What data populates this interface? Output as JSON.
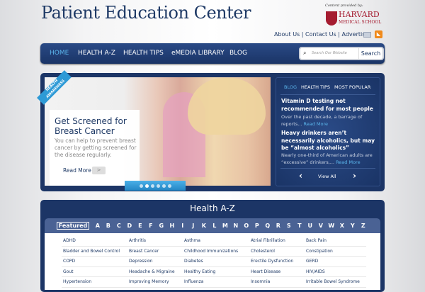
{
  "header": {
    "title": "Patient Education Center",
    "provided_by": "Content provided by:",
    "logo_line1": "HARVARD",
    "logo_line2": "MEDICAL SCHOOL",
    "links": [
      "About Us",
      "Contact Us",
      "Advertise"
    ],
    "sep": "|"
  },
  "nav": {
    "items": [
      "HOME",
      "HEALTH A-Z",
      "HEALTH TIPS",
      "eMEDIA LIBRARY",
      "BLOG"
    ],
    "active_color": "#5ab4ea",
    "search_placeholder": "Search Our Website",
    "search_button": "Search"
  },
  "hero": {
    "ribbon": "HEALTH AWARENESS",
    "title": "Get Screened for Breast Cancer",
    "text": "You can help to prevent breast cancer by getting screened for the disease regularly.",
    "read_more": "Read More",
    "read_more_arrow": ">",
    "slides": 6,
    "active_slide": 2
  },
  "blog": {
    "tabs": [
      "BLOG",
      "HEALTH TIPS",
      "MOST POPULAR"
    ],
    "posts": [
      {
        "title": "Vitamin D testing not recommended for most people",
        "excerpt": "Over the past decade, a barrage of reports...",
        "more": "Read More"
      },
      {
        "title": "Heavy drinkers aren’t necessarily alcoholics, but may be “almost alcoholics”",
        "excerpt": "Nearly one-third of American adults are “excessive” drinkers,...",
        "more": "Read More"
      }
    ],
    "prev": "‹",
    "view_all": "View All",
    "next": "›"
  },
  "az": {
    "title": "Health A-Z",
    "featured": "Featured",
    "letters": [
      "A",
      "B",
      "C",
      "D",
      "E",
      "F",
      "G",
      "H",
      "I",
      "J",
      "K",
      "L",
      "M",
      "N",
      "O",
      "P",
      "Q",
      "R",
      "S",
      "T",
      "U",
      "V",
      "W",
      "X",
      "Y",
      "Z"
    ],
    "rows": [
      [
        "ADHD",
        "Arthritis",
        "Asthma",
        "Atrial Fibrillation",
        "Back Pain"
      ],
      [
        "Bladder and Bowel Control",
        "Breast Cancer",
        "Childhood Immunizations",
        "Cholesterol",
        "Constipation"
      ],
      [
        "COPD",
        "Depression",
        "Diabetes",
        "Erectile Dysfunction",
        "GERD"
      ],
      [
        "Gout",
        "Headache & Migraine",
        "Healthy Eating",
        "Heart Disease",
        "HIV/AIDS"
      ],
      [
        "Hypertension",
        "Improving Memory",
        "Influenza",
        "Insomnia",
        "Irritable Bowel Syndrome"
      ]
    ]
  }
}
